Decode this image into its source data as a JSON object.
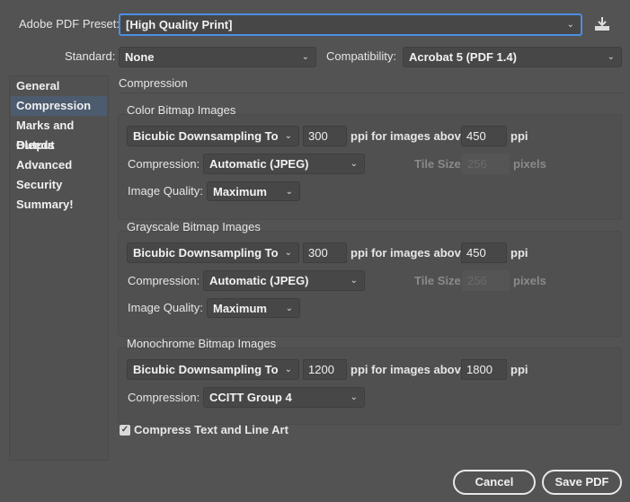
{
  "preset": {
    "label": "Adobe PDF Preset:",
    "value": "[High Quality Print]"
  },
  "standard": {
    "label": "Standard:",
    "value": "None"
  },
  "compatibility": {
    "label": "Compatibility:",
    "value": "Acrobat 5 (PDF 1.4)"
  },
  "sidebar": {
    "items": [
      {
        "label": "General"
      },
      {
        "label": "Compression",
        "selected": true
      },
      {
        "label": "Marks and Bleeds"
      },
      {
        "label": "Output"
      },
      {
        "label": "Advanced"
      },
      {
        "label": "Security"
      },
      {
        "label": "Summary!"
      }
    ]
  },
  "section_title": "Compression",
  "groups": [
    {
      "title": "Color Bitmap Images",
      "downsample": "Bicubic Downsampling To",
      "ppi": "300",
      "ppi_text": "ppi for images above",
      "above": "450",
      "ppi_unit": "ppi",
      "compression_label": "Compression:",
      "compression": "Automatic (JPEG)",
      "tile_label": "Tile Size:",
      "tile": "256",
      "tile_unit": "pixels",
      "quality_label": "Image Quality:",
      "quality": "Maximum"
    },
    {
      "title": "Grayscale Bitmap Images",
      "downsample": "Bicubic Downsampling To",
      "ppi": "300",
      "ppi_text": "ppi for images above",
      "above": "450",
      "ppi_unit": "ppi",
      "compression_label": "Compression:",
      "compression": "Automatic (JPEG)",
      "tile_label": "Tile Size:",
      "tile": "256",
      "tile_unit": "pixels",
      "quality_label": "Image Quality:",
      "quality": "Maximum"
    },
    {
      "title": "Monochrome Bitmap Images",
      "downsample": "Bicubic Downsampling To",
      "ppi": "1200",
      "ppi_text": "ppi for images above",
      "above": "1800",
      "ppi_unit": "ppi",
      "compression_label": "Compression:",
      "compression": "CCITT Group 4"
    }
  ],
  "compress_text": {
    "label": "Compress Text and Line Art",
    "checked": true
  },
  "buttons": {
    "cancel": "Cancel",
    "save": "Save PDF"
  },
  "chevron": "⌄",
  "colors": {
    "background": "#535353",
    "focus": "#4a90e2",
    "selected": "#4d5b6e"
  }
}
